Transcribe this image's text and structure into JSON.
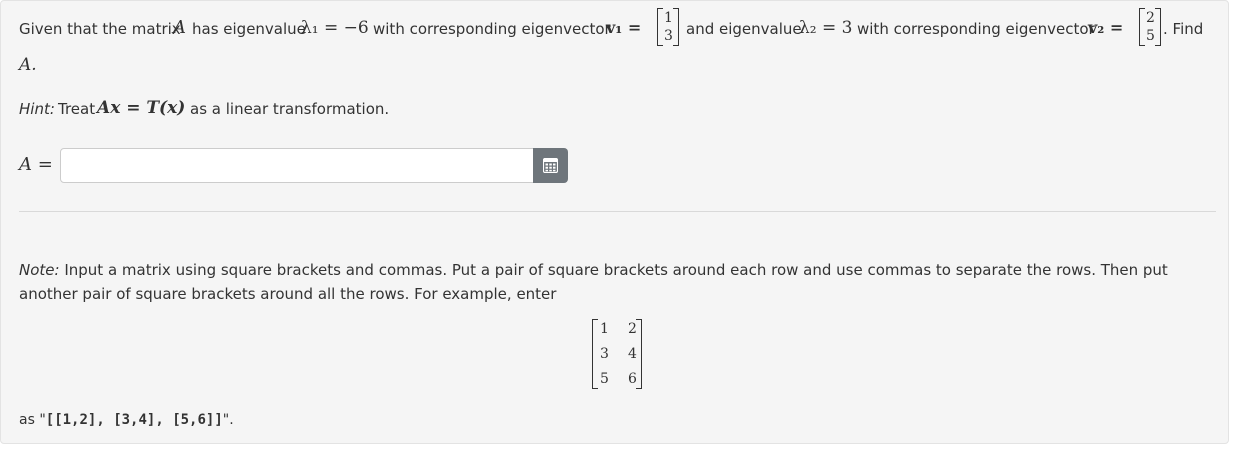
{
  "question": {
    "text_given": "Given that the matrix",
    "var_A": "A",
    "text_has_eig": "has eigenvalue",
    "lambda1": "λ₁ = −6",
    "text_with_vec": "with corresponding eigenvector",
    "v1_label": "v₁ =",
    "v1_entries": [
      "1",
      "3"
    ],
    "text_and_eig": "and eigenvalue",
    "lambda2": "λ₂ = 3",
    "text_with_vec2": "with corresponding eigenvector",
    "v2_label": "v₂ =",
    "v2_entries": [
      "2",
      "5"
    ],
    "text_find": ". Find",
    "text_A_end": "A."
  },
  "hint": {
    "label": "Hint:",
    "text_treat": "Treat",
    "equation": "Ax = T(x)",
    "text_rest": "as a linear transformation."
  },
  "answer": {
    "label": "A =",
    "value": "",
    "placeholder": "",
    "button_icon": "matrix-grid-icon"
  },
  "note": {
    "label": "Note:",
    "text": "Input a matrix using square brackets and commas. Put a pair of square brackets around each row and use commas to separate the rows. Then put another pair of square brackets around all the rows. For example, enter",
    "example_matrix": [
      [
        "1",
        "2"
      ],
      [
        "3",
        "4"
      ],
      [
        "5",
        "6"
      ]
    ],
    "as_prefix": "as \"",
    "example_code": "[[1,2], [3,4], [5,6]]",
    "as_suffix": "\"."
  }
}
